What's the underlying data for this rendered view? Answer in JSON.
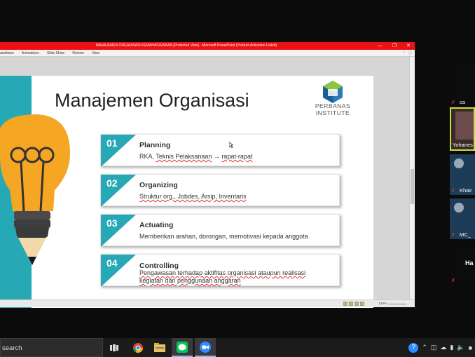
{
  "powerpoint": {
    "window_title": "MANAJEMEN ORGANISASI KEMAHASISWAAN [Protected View] - Microsoft PowerPoint (Product Activation Failed)",
    "ribbon_tabs": [
      "ansitions",
      "Animations",
      "Slide Show",
      "Review",
      "View"
    ],
    "zoom_level": "134%"
  },
  "slide": {
    "title": "Manajemen Organisasi",
    "logo_line1": "PERBANAS",
    "logo_line2": "INSTITUTE",
    "items": [
      {
        "num": "01",
        "heading": "Planning",
        "desc_a": "RKA, ",
        "desc_b": "Teknis Pelaksanaan",
        "desc_c": " → ",
        "desc_d": "rapat-rapat"
      },
      {
        "num": "02",
        "heading": "Organizing",
        "desc": "Struktur org., Jobdes, Arsip, Inventaris"
      },
      {
        "num": "03",
        "heading": "Actuating",
        "desc": "Memberikan arahan, dorongan, memotivasi kepada anggota"
      },
      {
        "num": "04",
        "heading": "Controlling",
        "desc_line1": "Pengawasan terhadap aktifitas organisasi ataupun realisasi",
        "desc_line2": "kegiatan dan penggunaan anggaran"
      }
    ]
  },
  "participants": [
    {
      "name": "ca"
    },
    {
      "name": "Yohanes"
    },
    {
      "name": "Khair"
    },
    {
      "name": "MC_"
    },
    {
      "name": "Ha"
    }
  ],
  "taskbar": {
    "search_placeholder": "search"
  },
  "colors": {
    "teal": "#27a9b5",
    "title_bar": "#e11111",
    "bulb": "#f5a623"
  }
}
